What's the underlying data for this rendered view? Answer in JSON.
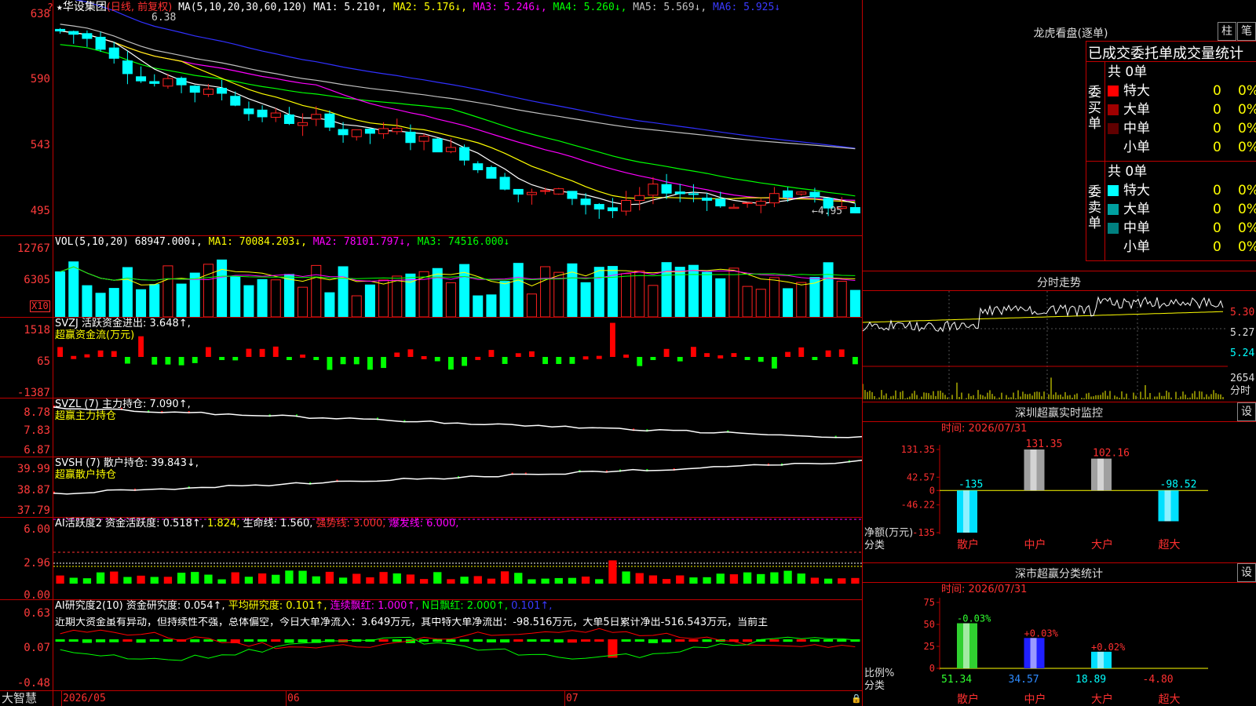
{
  "stock": {
    "star": "★",
    "name": "华设集团",
    "period": "(日线, 前复权)",
    "ma_prefix": "MA(5,10,20,30,60,120)",
    "ma1": "MA1: 5.210↑,",
    "ma2": "MA2: 5.176↓,",
    "ma3": "MA3: 5.246↓,",
    "ma4": "MA4: 5.260↓,",
    "ma5": "MA5: 5.569↓,",
    "ma6": "MA6: 5.925↓",
    "high_mark": "6.38",
    "low_mark": "4.95",
    "question": "?",
    "y_labels": [
      "638",
      "590",
      "543",
      "495"
    ],
    "colors": {
      "up": "#ff2020",
      "down": "#00ffff",
      "ma1": "#ffffff",
      "ma2": "#ffff00",
      "ma3": "#ff00ff",
      "ma4": "#00ff00",
      "ma5": "#c0c0c0",
      "ma6": "#3030ff"
    }
  },
  "vol": {
    "title": "VOL(5,10,20)",
    "value": "68947.000↓,",
    "ma1": "MA1: 70084.203↓,",
    "ma2": "MA2: 78101.797↓,",
    "ma3": "MA3: 74516.000↓",
    "y_labels": [
      "12767",
      "6305"
    ],
    "unit": "X10"
  },
  "svzj": {
    "title": "SVZJ  活跃资金进出: 3.648↑,",
    "subtitle": "超赢资金流(万元)",
    "y_labels": [
      "1518",
      "65",
      "-1387"
    ]
  },
  "svzl": {
    "title": "SVZL (7) 主力持仓: 7.090↑,",
    "subtitle": "超赢主力持仓",
    "y_labels": [
      "8.78",
      "7.83",
      "6.87"
    ]
  },
  "svsh": {
    "title": "SVSH (7) 散户持仓: 39.843↓,",
    "subtitle": "超赢散户持仓",
    "y_labels": [
      "39.99",
      "38.87",
      "37.79"
    ]
  },
  "ai1": {
    "title": "AI活跃度2 资金活跃度: 0.518↑,",
    "v2": "1.824,",
    "v3": "生命线: 1.560,",
    "v4": "强势线: 3.000,",
    "v5": "爆发线: 6.000,",
    "y_labels": [
      "6.00",
      "2.96",
      "0.00"
    ]
  },
  "ai2": {
    "title": "AI研究度2(10) 资金研究度: 0.054↑,",
    "v2": "平均研究度: 0.101↑,",
    "v3": "连续飘红: 1.000↑,",
    "v4": "N日飘红: 2.000↑,",
    "v5": "0.101↑,",
    "comment": "近期大资金虽有异动，但持续性不强，总体偏空，今日大单净流入：3.649万元，其中特大单净流出：-98.516万元，大单5日累计净出-516.543万元，当前主",
    "y_labels": [
      "0.63",
      "0.07",
      "-0.48"
    ]
  },
  "footer": {
    "brand": "大智慧",
    "dates": [
      "2026/05",
      "06",
      "07"
    ]
  },
  "longhu": {
    "title": "龙虎看盘(逐单)",
    "btn1": "柱",
    "btn2": "笔",
    "tabs": "已成交委托单成交量统计",
    "buy_label": "委买单",
    "sell_label": "委卖单",
    "buy_total": "共 0单",
    "sell_total": "共 0单",
    "buy_rows": [
      {
        "name": "特大",
        "count": "0",
        "pct": "0%",
        "color": "#ff0000"
      },
      {
        "name": "大单",
        "count": "0",
        "pct": "0%",
        "color": "#a00000"
      },
      {
        "name": "中单",
        "count": "0",
        "pct": "0%",
        "color": "#600000"
      },
      {
        "name": "小单",
        "count": "0",
        "pct": "0%",
        "color": ""
      }
    ],
    "sell_rows": [
      {
        "name": "特大",
        "count": "0",
        "pct": "0%",
        "color": "#00ffff"
      },
      {
        "name": "大单",
        "count": "0",
        "pct": "0%",
        "color": "#00a0a0"
      },
      {
        "name": "中单",
        "count": "0",
        "pct": "0%",
        "color": "#008080"
      },
      {
        "name": "小单",
        "count": "0",
        "pct": "0%",
        "color": ""
      }
    ]
  },
  "fenshi": {
    "title": "分时走势",
    "prices": [
      "5.30",
      "5.27",
      "5.24"
    ],
    "vol": "2654",
    "vol_unit": "分时"
  },
  "monitor": {
    "title": "深圳超赢实时监控",
    "btn": "设",
    "time": "时间: 2026/07/31",
    "y_labels": [
      "131.35",
      "42.57",
      "0",
      "-46.22",
      "-135"
    ],
    "axis_title": "净额(万元)",
    "axis_sub": "分类",
    "categories": [
      "散户",
      "中户",
      "大户",
      "超大"
    ],
    "values": [
      -135,
      131.35,
      102.16,
      -98.52
    ],
    "value_labels": [
      "-135",
      "131.35",
      "102.16",
      "-98.52"
    ]
  },
  "classify": {
    "title": "深市超赢分类统计",
    "btn": "设",
    "time": "时间: 2026/07/31",
    "y_labels": [
      "75",
      "50",
      "25",
      "0"
    ],
    "axis_title": "比例%",
    "axis_sub": "分类",
    "categories": [
      "散户",
      "中户",
      "大户",
      "超大"
    ],
    "values": [
      51.34,
      34.57,
      18.89,
      -4.8
    ],
    "value_labels": [
      "51.34",
      "34.57",
      "18.89",
      "-4.80"
    ],
    "change_labels": [
      "-0.03%",
      "+0.03%",
      "+0.02%",
      ""
    ]
  }
}
